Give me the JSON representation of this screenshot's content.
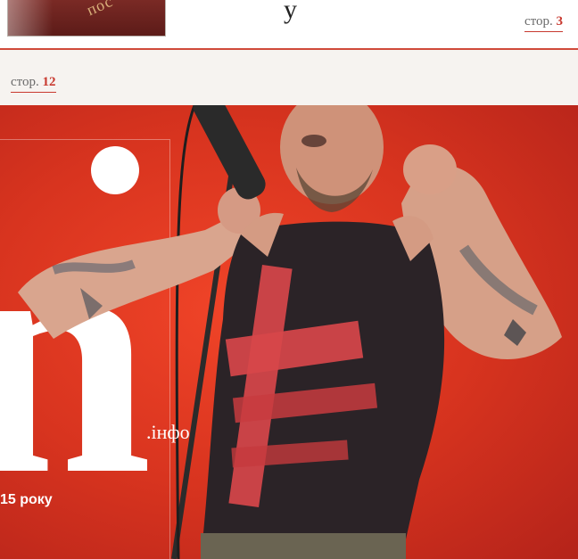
{
  "top_banner": {
    "book_lettering": "пос",
    "title_glyph": "у",
    "page_ref": {
      "prefix": "стор.",
      "number": "3"
    }
  },
  "section_band": {
    "page_ref": {
      "prefix": "стор.",
      "number": "12"
    }
  },
  "cover": {
    "masthead_letter": "n",
    "domain_suffix": ".інфо",
    "headline_snippet": "15 року"
  },
  "colors": {
    "accent_red": "#c8392f",
    "hero_red": "#e23a22"
  }
}
